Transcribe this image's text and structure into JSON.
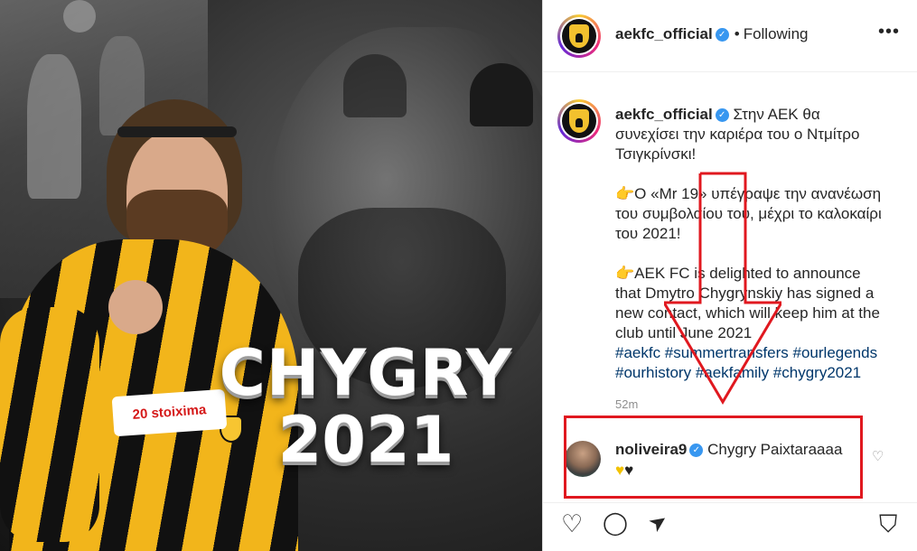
{
  "post_image": {
    "headline_line1": "CHYGRY",
    "headline_line2": "2021",
    "sponsor_text": "stoixima",
    "sponsor_prefix": "20",
    "shirt_colors": [
      "#f2b51b",
      "#111111"
    ]
  },
  "header": {
    "username": "aekfc_official",
    "verified_icon": "✓",
    "separator": "•",
    "follow_status": "Following",
    "more_label": "•••"
  },
  "caption": {
    "username": "aekfc_official",
    "verified_icon": "✓",
    "line1": "Στην ΑΕΚ θα συνεχίσει την καριέρα του ο Ντμίτρο Τσιγκρίνσκι!",
    "line2": "👉Ο «Mr 19» υπέγραψε την ανανέωση του συμβολαίου του, μέχρι το καλοκαίρι του 2021!",
    "line3": "👉AEK FC is delighted to announce that Dmytro Chygrynskiy has signed a new contact, which will keep him at the club until June 2021",
    "hashtags": "#aekfc #summertransfers #ourlegends #ourhistory #aekfamily #chygry2021",
    "time": "52m"
  },
  "comment": {
    "username": "noliveira9",
    "verified_icon": "✓",
    "text": "Chygry Paixtaraaaa",
    "emoji_yellow": "♥",
    "emoji_black": "♥",
    "like_icon": "♡"
  },
  "actions": {
    "like_icon": "♡",
    "comment_icon": "◯",
    "share_icon": "➤",
    "save_icon": "⛉"
  },
  "colors": {
    "annotation_red": "#e0181f",
    "link_blue": "#00376b",
    "verified_blue": "#3897f0"
  }
}
